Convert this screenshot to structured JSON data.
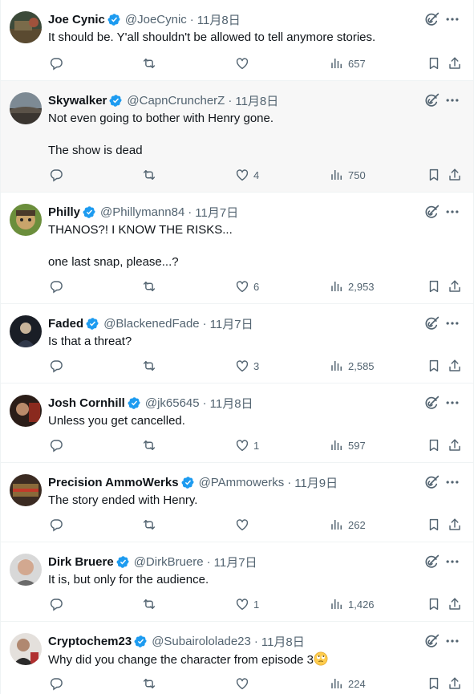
{
  "tweets": [
    {
      "name": "Joe Cynic",
      "handle": "@JoeCynic",
      "time": "11月8日",
      "lines": [
        "It should be. Y'all shouldn't be allowed to tell anymore stories."
      ],
      "likes": "",
      "views": "657"
    },
    {
      "name": "Skywalker",
      "handle": "@CapnCruncherZ",
      "time": "11月8日",
      "lines": [
        "Not even going to bother with Henry gone.",
        "The show is dead"
      ],
      "likes": "4",
      "views": "750"
    },
    {
      "name": "Philly",
      "handle": "@Phillymann84",
      "time": "11月7日",
      "lines": [
        "THANOS?! I KNOW THE RISKS...",
        "one last snap, please...?"
      ],
      "likes": "6",
      "views": "2,953"
    },
    {
      "name": "Faded",
      "handle": "@BlackenedFade",
      "time": "11月7日",
      "lines": [
        "Is that a threat?"
      ],
      "likes": "3",
      "views": "2,585"
    },
    {
      "name": "Josh Cornhill",
      "handle": "@jk65645",
      "time": "11月8日",
      "lines": [
        "Unless you get cancelled."
      ],
      "likes": "1",
      "views": "597"
    },
    {
      "name": "Precision AmmoWerks",
      "handle": "@PAmmowerks",
      "time": "11月9日",
      "lines": [
        "The story ended with Henry."
      ],
      "likes": "",
      "views": "262"
    },
    {
      "name": "Dirk Bruere",
      "handle": "@DirkBruere",
      "time": "11月7日",
      "lines": [
        "It is, but only for the audience."
      ],
      "likes": "1",
      "views": "1,426"
    },
    {
      "name": "Cryptochem23",
      "handle": "@Subairololade23",
      "time": "11月8日",
      "lines": [
        "Why did you change the character from episode 3"
      ],
      "likes": "",
      "views": "224"
    }
  ],
  "separator": "·",
  "icons": {
    "verified": "verified-badge-icon",
    "grok": "grok-icon",
    "more": "more-icon",
    "reply": "reply-icon",
    "retweet": "retweet-icon",
    "like": "like-icon",
    "views": "views-icon",
    "bookmark": "bookmark-icon",
    "share": "share-icon",
    "emoji": "rolling-eyes-emoji"
  },
  "colors": {
    "verified": "#1d9bf0",
    "text": "#0f1419",
    "secondary": "#536471",
    "highlight": "#f7f7f7",
    "divider": "#eff3f4"
  }
}
